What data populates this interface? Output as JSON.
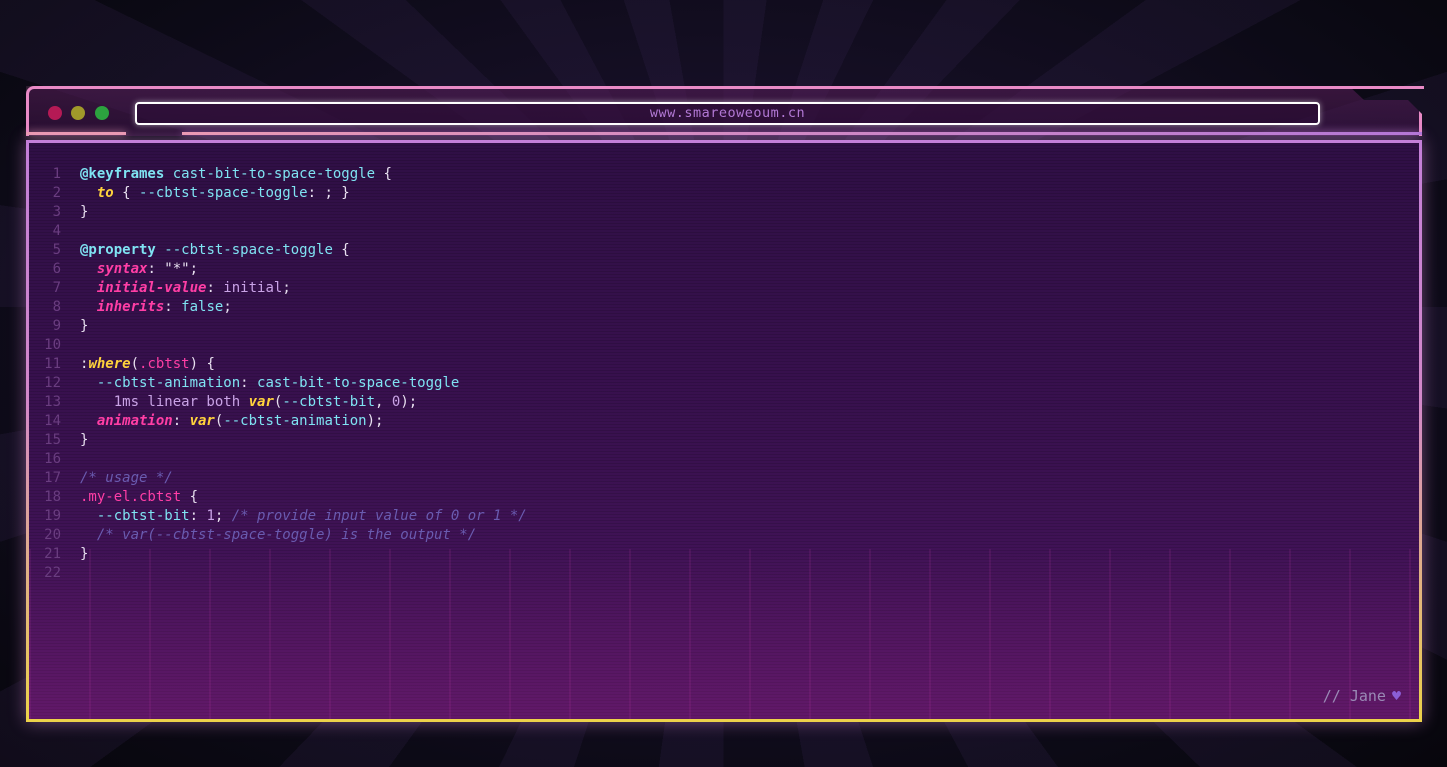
{
  "browser": {
    "url": "www.smareoweoum.cn"
  },
  "code_lines": [
    {
      "n": "1",
      "tokens": [
        [
          "at",
          "@keyframes"
        ],
        [
          "p",
          " "
        ],
        [
          "name",
          "cast-bit-to-space-toggle"
        ],
        [
          "p",
          " {"
        ]
      ]
    },
    {
      "n": "2",
      "tokens": [
        [
          "p",
          "  "
        ],
        [
          "kw",
          "to"
        ],
        [
          "p",
          " { "
        ],
        [
          "var",
          "--cbtst-space-toggle"
        ],
        [
          "p",
          ": ; }"
        ]
      ]
    },
    {
      "n": "3",
      "tokens": [
        [
          "p",
          "}"
        ]
      ]
    },
    {
      "n": "4",
      "tokens": []
    },
    {
      "n": "5",
      "tokens": [
        [
          "at",
          "@property"
        ],
        [
          "p",
          " "
        ],
        [
          "name",
          "--cbtst-space-toggle"
        ],
        [
          "p",
          " {"
        ]
      ]
    },
    {
      "n": "6",
      "tokens": [
        [
          "p",
          "  "
        ],
        [
          "prop",
          "syntax"
        ],
        [
          "p",
          ": "
        ],
        [
          "str",
          "\"*\""
        ],
        [
          "p",
          ";"
        ]
      ]
    },
    {
      "n": "7",
      "tokens": [
        [
          "p",
          "  "
        ],
        [
          "prop",
          "initial-value"
        ],
        [
          "p",
          ": "
        ],
        [
          "val",
          "initial"
        ],
        [
          "p",
          ";"
        ]
      ]
    },
    {
      "n": "8",
      "tokens": [
        [
          "p",
          "  "
        ],
        [
          "prop",
          "inherits"
        ],
        [
          "p",
          ": "
        ],
        [
          "var",
          "false"
        ],
        [
          "p",
          ";"
        ]
      ]
    },
    {
      "n": "9",
      "tokens": [
        [
          "p",
          "}"
        ]
      ]
    },
    {
      "n": "10",
      "tokens": []
    },
    {
      "n": "11",
      "tokens": [
        [
          "p",
          ":"
        ],
        [
          "kw",
          "where"
        ],
        [
          "p",
          "("
        ],
        [
          "sel",
          ".cbtst"
        ],
        [
          "p",
          ") {"
        ]
      ]
    },
    {
      "n": "12",
      "tokens": [
        [
          "p",
          "  "
        ],
        [
          "var",
          "--cbtst-animation"
        ],
        [
          "p",
          ": "
        ],
        [
          "name",
          "cast-bit-to-space-toggle"
        ]
      ]
    },
    {
      "n": "13",
      "tokens": [
        [
          "p",
          "    "
        ],
        [
          "val",
          "1ms linear both"
        ],
        [
          "p",
          " "
        ],
        [
          "kw",
          "var"
        ],
        [
          "p",
          "("
        ],
        [
          "var",
          "--cbtst-bit"
        ],
        [
          "p",
          ", "
        ],
        [
          "num",
          "0"
        ],
        [
          "p",
          ");"
        ]
      ]
    },
    {
      "n": "14",
      "tokens": [
        [
          "p",
          "  "
        ],
        [
          "prop",
          "animation"
        ],
        [
          "p",
          ": "
        ],
        [
          "kw",
          "var"
        ],
        [
          "p",
          "("
        ],
        [
          "var",
          "--cbtst-animation"
        ],
        [
          "p",
          ");"
        ]
      ]
    },
    {
      "n": "15",
      "tokens": [
        [
          "p",
          "}"
        ]
      ]
    },
    {
      "n": "16",
      "tokens": []
    },
    {
      "n": "17",
      "tokens": [
        [
          "cm",
          "/* usage */"
        ]
      ]
    },
    {
      "n": "18",
      "tokens": [
        [
          "sel",
          ".my-el.cbtst"
        ],
        [
          "p",
          " {"
        ]
      ]
    },
    {
      "n": "19",
      "tokens": [
        [
          "p",
          "  "
        ],
        [
          "var",
          "--cbtst-bit"
        ],
        [
          "p",
          ": "
        ],
        [
          "num",
          "1"
        ],
        [
          "p",
          "; "
        ],
        [
          "cm",
          "/* provide input value of 0 or 1 */"
        ]
      ]
    },
    {
      "n": "20",
      "tokens": [
        [
          "p",
          "  "
        ],
        [
          "cm",
          "/* var(--cbtst-space-toggle) is the output */"
        ]
      ]
    },
    {
      "n": "21",
      "tokens": [
        [
          "p",
          "}"
        ]
      ]
    },
    {
      "n": "22",
      "tokens": []
    }
  ],
  "signature": {
    "text": "// Jane",
    "icon": "heart-icon"
  },
  "colors": {
    "keyword_yellow": "#ffd23c",
    "property_pink": "#ff3ea5",
    "at_rule_cyan": "#7fe3f2",
    "comment_purple": "#6a5bb0"
  }
}
